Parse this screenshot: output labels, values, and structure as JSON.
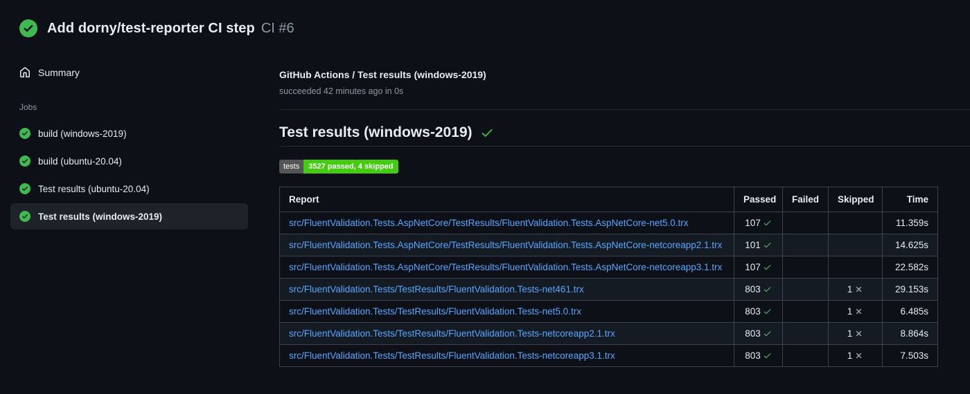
{
  "colors": {
    "background": "#0d1117",
    "link": "#58a6ff",
    "success_green": "#3fb950",
    "muted_text": "#9198a1",
    "badge_label_bg": "#555555",
    "badge_value_bg": "#44cc11",
    "table_border": "#3d444d"
  },
  "run_header": {
    "title": "Add dorny/test-reporter CI step",
    "run_number": "CI #6",
    "status_icon": "check-circle-icon"
  },
  "sidebar": {
    "summary_label": "Summary",
    "summary_icon": "home-icon",
    "jobs_label": "Jobs",
    "jobs": [
      {
        "label": "build (windows-2019)",
        "status_icon": "check-circle-icon",
        "selected": false
      },
      {
        "label": "build (ubuntu-20.04)",
        "status_icon": "check-circle-icon",
        "selected": false
      },
      {
        "label": "Test results (ubuntu-20.04)",
        "status_icon": "check-circle-icon",
        "selected": false
      },
      {
        "label": "Test results (windows-2019)",
        "status_icon": "check-circle-icon",
        "selected": true
      }
    ]
  },
  "main": {
    "check_title": "GitHub Actions / Test results (windows-2019)",
    "check_status": "succeeded 42 minutes ago in 0s",
    "section_title": "Test results (windows-2019)",
    "section_status_icon": "check-icon",
    "badge": {
      "label": "tests",
      "value": "3527 passed, 4 skipped"
    },
    "table": {
      "headers": [
        "Report",
        "Passed",
        "Failed",
        "Skipped",
        "Time"
      ],
      "passed_icon": "check-icon",
      "skipped_icon": "x-icon",
      "rows": [
        {
          "report": "src/FluentValidation.Tests.AspNetCore/TestResults/FluentValidation.Tests.AspNetCore-net5.0.trx",
          "passed": "107",
          "failed": "",
          "skipped": "",
          "time": "11.359s"
        },
        {
          "report": "src/FluentValidation.Tests.AspNetCore/TestResults/FluentValidation.Tests.AspNetCore-netcoreapp2.1.trx",
          "passed": "101",
          "failed": "",
          "skipped": "",
          "time": "14.625s"
        },
        {
          "report": "src/FluentValidation.Tests.AspNetCore/TestResults/FluentValidation.Tests.AspNetCore-netcoreapp3.1.trx",
          "passed": "107",
          "failed": "",
          "skipped": "",
          "time": "22.582s"
        },
        {
          "report": "src/FluentValidation.Tests/TestResults/FluentValidation.Tests-net461.trx",
          "passed": "803",
          "failed": "",
          "skipped": "1",
          "time": "29.153s"
        },
        {
          "report": "src/FluentValidation.Tests/TestResults/FluentValidation.Tests-net5.0.trx",
          "passed": "803",
          "failed": "",
          "skipped": "1",
          "time": "6.485s"
        },
        {
          "report": "src/FluentValidation.Tests/TestResults/FluentValidation.Tests-netcoreapp2.1.trx",
          "passed": "803",
          "failed": "",
          "skipped": "1",
          "time": "8.864s"
        },
        {
          "report": "src/FluentValidation.Tests/TestResults/FluentValidation.Tests-netcoreapp3.1.trx",
          "passed": "803",
          "failed": "",
          "skipped": "1",
          "time": "7.503s"
        }
      ]
    }
  }
}
